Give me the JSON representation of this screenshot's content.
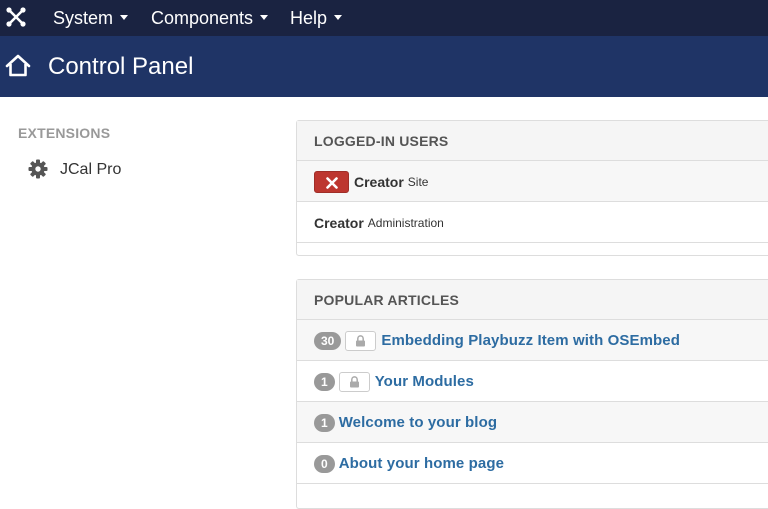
{
  "navbar": {
    "logo_icon": "joomla-logo-icon",
    "menus": [
      {
        "label": "System"
      },
      {
        "label": "Components"
      },
      {
        "label": "Help"
      }
    ]
  },
  "header": {
    "icon": "home-icon",
    "title": "Control Panel"
  },
  "sidebar": {
    "heading": "EXTENSIONS",
    "items": [
      {
        "label": "JCal Pro",
        "icon": "gear-icon"
      }
    ]
  },
  "logged_in_users": {
    "title": "LOGGED-IN USERS",
    "rows": [
      {
        "name": "Creator",
        "location": "Site",
        "logout_icon": "close-icon"
      },
      {
        "name": "Creator",
        "location": "Administration"
      }
    ]
  },
  "popular_articles": {
    "title": "POPULAR ARTICLES",
    "rows": [
      {
        "hits": "30",
        "locked": true,
        "title": "Embedding Playbuzz Item with OSEmbed"
      },
      {
        "hits": "1",
        "locked": true,
        "title": "Your Modules"
      },
      {
        "hits": "1",
        "locked": false,
        "title": "Welcome to your blog"
      },
      {
        "hits": "0",
        "locked": false,
        "title": "About your home page"
      }
    ]
  },
  "colors": {
    "navbar_bg": "#1a2341",
    "header_bg": "#1f3466",
    "danger": "#bd362f",
    "link": "#2d6ca2",
    "badge": "#999999"
  }
}
